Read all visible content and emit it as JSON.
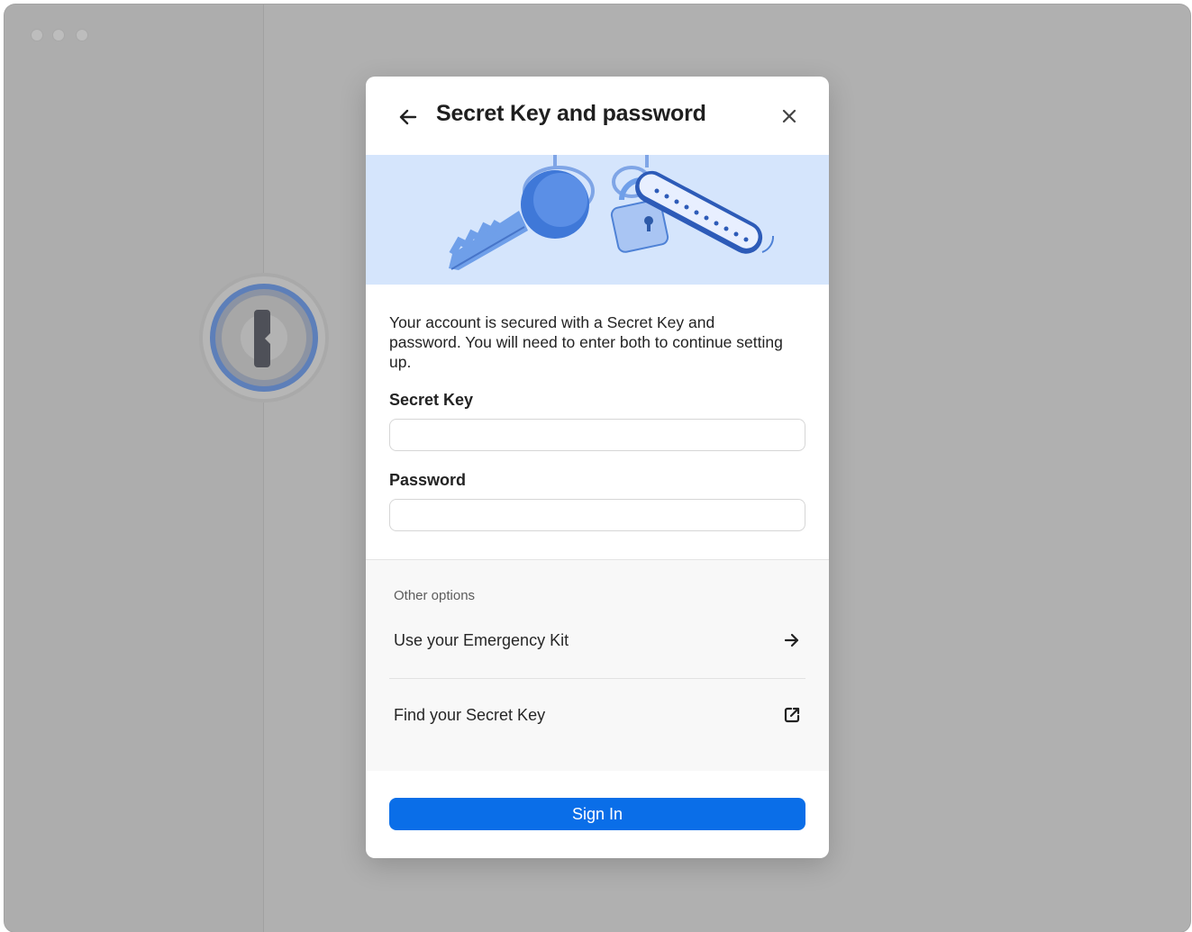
{
  "app": {
    "logo_name": "1password-logo"
  },
  "modal": {
    "title": "Secret Key and password",
    "description": "Your account is secured with a Secret Key and password. You will need to enter both to continue setting up.",
    "secret_key": {
      "label": "Secret Key",
      "value": "",
      "placeholder": ""
    },
    "password": {
      "label": "Password",
      "value": "",
      "placeholder": ""
    },
    "other_options": {
      "heading": "Other options",
      "items": [
        {
          "label": "Use your Emergency Kit",
          "icon": "arrow-right-icon"
        },
        {
          "label": "Find your Secret Key",
          "icon": "external-link-icon"
        }
      ]
    },
    "sign_in_label": "Sign In"
  },
  "colors": {
    "primary": "#0a6ee8",
    "hero_bg": "#d5e5fc",
    "overlay": "#b0b0b0"
  }
}
